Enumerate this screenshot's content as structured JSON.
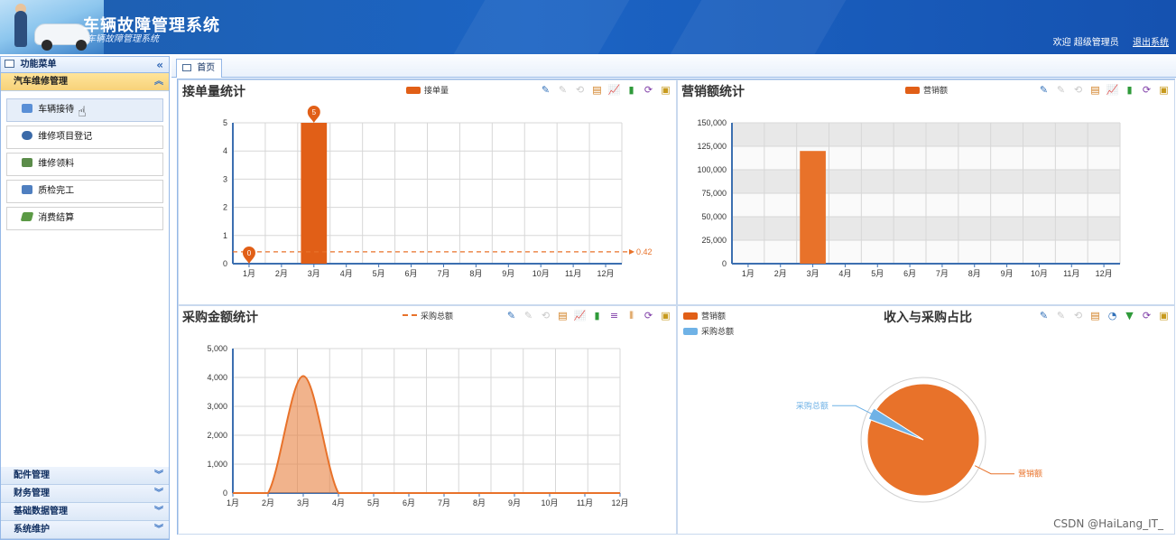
{
  "header": {
    "title": "车辆故障管理系统",
    "subtitle": "车辆故障管理系统",
    "welcome": "欢迎 超级管理员",
    "logout": "退出系统"
  },
  "sidebar": {
    "title": "功能菜单",
    "active_section": "汽车维修管理",
    "items": [
      {
        "label": "车辆接待",
        "color": "#5a8fd6"
      },
      {
        "label": "维修项目登记",
        "color": "#3b6aa8"
      },
      {
        "label": "维修领料",
        "color": "#5b8c4a"
      },
      {
        "label": "质检完工",
        "color": "#4f7fc0"
      },
      {
        "label": "消费结算",
        "color": "#5b9a45"
      }
    ],
    "sections": [
      "配件管理",
      "财务管理",
      "基础数据管理",
      "系统维护"
    ]
  },
  "tabs": [
    {
      "label": "首页"
    }
  ],
  "toolbox_icons": {
    "orders": [
      "pencil-icon",
      "eraser-icon",
      "reset-icon",
      "data-view-icon",
      "line-icon",
      "bar-icon",
      "refresh-icon",
      "save-icon"
    ],
    "sales": [
      "pencil-icon",
      "eraser-icon",
      "reset-icon",
      "data-view-icon",
      "line-icon",
      "bar-icon",
      "refresh-icon",
      "save-icon"
    ],
    "purchase": [
      "pencil-icon",
      "eraser-icon",
      "reset-icon",
      "data-view-icon",
      "line-icon",
      "bar-icon",
      "stack-icon",
      "tiled-icon",
      "refresh-icon",
      "save-icon"
    ],
    "pie": [
      "pencil-icon",
      "eraser-icon",
      "reset-icon",
      "data-view-icon",
      "pie-icon",
      "funnel-icon",
      "refresh-icon",
      "save-icon"
    ]
  },
  "colors": {
    "accent": "#e8722a",
    "bar": "#e15f17",
    "pie_blue": "#6fb2e6",
    "axis": "#3c6fb0"
  },
  "chart_data": [
    {
      "type": "bar",
      "title": "接单量统计",
      "categories": [
        "1月",
        "2月",
        "3月",
        "4月",
        "5月",
        "6月",
        "7月",
        "8月",
        "9月",
        "10月",
        "11月",
        "12月"
      ],
      "series": [
        {
          "name": "接单量",
          "values": [
            0,
            0,
            5,
            0,
            0,
            0,
            0,
            0,
            0,
            0,
            0,
            0
          ]
        }
      ],
      "ylim": [
        0,
        5
      ],
      "yticks": [
        "0",
        "1",
        "2",
        "3",
        "4",
        "5"
      ],
      "mark_points": [
        {
          "label": "5",
          "month": "3月",
          "value": 5
        },
        {
          "label": "0",
          "month": "1月",
          "value": 0
        }
      ],
      "mark_line": {
        "label": "0.42",
        "value": 0.42
      },
      "legend_position": "top-center"
    },
    {
      "type": "bar",
      "title": "营销额统计",
      "categories": [
        "1月",
        "2月",
        "3月",
        "4月",
        "5月",
        "6月",
        "7月",
        "8月",
        "9月",
        "10月",
        "11月",
        "12月"
      ],
      "series": [
        {
          "name": "营销额",
          "values": [
            0,
            0,
            120000,
            0,
            0,
            0,
            0,
            0,
            0,
            0,
            0,
            0
          ]
        }
      ],
      "ylim": [
        0,
        150000
      ],
      "yticks": [
        "0",
        "25,000",
        "50,000",
        "75,000",
        "100,000",
        "125,000",
        "150,000"
      ],
      "legend_position": "top-center"
    },
    {
      "type": "area",
      "title": "采购金额统计",
      "categories": [
        "1月",
        "2月",
        "3月",
        "4月",
        "5月",
        "6月",
        "7月",
        "8月",
        "9月",
        "10月",
        "11月",
        "12月"
      ],
      "series": [
        {
          "name": "采购总额",
          "values": [
            0,
            0,
            4050,
            0,
            0,
            0,
            0,
            0,
            0,
            0,
            0,
            0
          ]
        }
      ],
      "ylim": [
        0,
        5000
      ],
      "yticks": [
        "0",
        "1,000",
        "2,000",
        "3,000",
        "4,000",
        "5,000"
      ],
      "legend_position": "top-center"
    },
    {
      "type": "pie",
      "title": "收入与采购占比",
      "series": [
        {
          "name": "营销额",
          "value": 120000
        },
        {
          "name": "采购总额",
          "value": 4050
        }
      ],
      "legend_position": "top-left"
    }
  ],
  "watermark": "CSDN @HaiLang_IT_"
}
